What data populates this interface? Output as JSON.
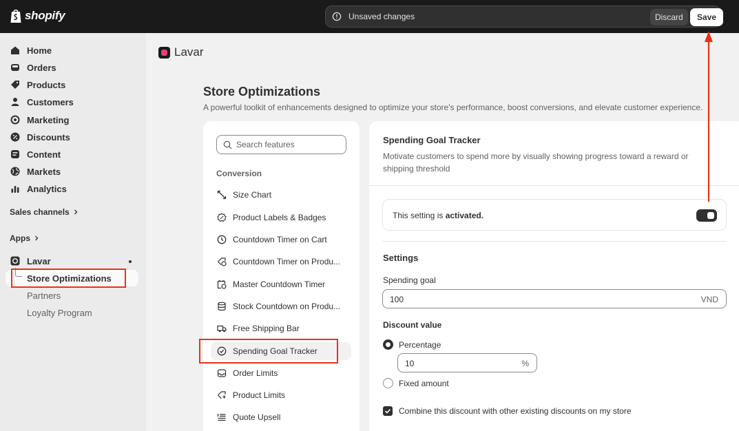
{
  "topbar": {
    "brand": "shopify",
    "unsaved_text": "Unsaved changes",
    "discard_label": "Discard",
    "save_label": "Save"
  },
  "sidebar": {
    "items": [
      {
        "label": "Home",
        "icon": "home-icon"
      },
      {
        "label": "Orders",
        "icon": "orders-icon"
      },
      {
        "label": "Products",
        "icon": "tag-icon"
      },
      {
        "label": "Customers",
        "icon": "person-icon"
      },
      {
        "label": "Marketing",
        "icon": "target-icon"
      },
      {
        "label": "Discounts",
        "icon": "discount-icon"
      },
      {
        "label": "Content",
        "icon": "content-icon"
      },
      {
        "label": "Markets",
        "icon": "globe-icon"
      },
      {
        "label": "Analytics",
        "icon": "bar-chart-icon"
      }
    ],
    "sales_channels": "Sales channels",
    "apps": "Apps",
    "app_name": "Lavar",
    "app_subitems": [
      "Store Optimizations",
      "Partners",
      "Loyalty Program"
    ]
  },
  "main": {
    "app_title": "Lavar",
    "page_title": "Store Optimizations",
    "page_subtitle": "A powerful toolkit of enhancements designed to optimize your store's performance, boost conversions, and elevate customer experience.",
    "search_placeholder": "Search features",
    "group_label": "Conversion",
    "features": [
      {
        "label": "Size Chart",
        "icon": "ruler-icon"
      },
      {
        "label": "Product Labels & Badges",
        "icon": "badge-icon"
      },
      {
        "label": "Countdown Timer on Cart",
        "icon": "clock-icon"
      },
      {
        "label": "Countdown Timer on Produ...",
        "icon": "tag-clock-icon"
      },
      {
        "label": "Master Countdown Timer",
        "icon": "calendar-clock-icon"
      },
      {
        "label": "Stock Countdown on Produ...",
        "icon": "database-icon"
      },
      {
        "label": "Free Shipping Bar",
        "icon": "truck-icon"
      },
      {
        "label": "Spending Goal Tracker",
        "icon": "check-circle-icon"
      },
      {
        "label": "Order Limits",
        "icon": "inbox-icon"
      },
      {
        "label": "Product Limits",
        "icon": "tag-limit-icon"
      },
      {
        "label": "Quote Upsell",
        "icon": "list-icon"
      }
    ],
    "active_feature": "Spending Goal Tracker"
  },
  "detail": {
    "title": "Spending Goal Tracker",
    "description": "Motivate customers to spend more by visually showing progress toward a reward or shipping threshold",
    "activation_prefix": "This setting is ",
    "activation_state": "activated.",
    "activated": true,
    "settings_heading": "Settings",
    "spending_goal_label": "Spending goal",
    "spending_goal_value": "100",
    "spending_goal_currency": "VND",
    "discount_heading": "Discount value",
    "discount_options": [
      "Percentage",
      "Fixed amount"
    ],
    "discount_selected": "Percentage",
    "percentage_value": "10",
    "percentage_suffix": "%",
    "combine_label": "Combine this discount with other existing discounts on my store",
    "combine_checked": true
  },
  "colors": {
    "annotation_red": "#e83118",
    "topbar_bg": "#1a1a1a",
    "sidebar_bg": "#ebebeb"
  }
}
